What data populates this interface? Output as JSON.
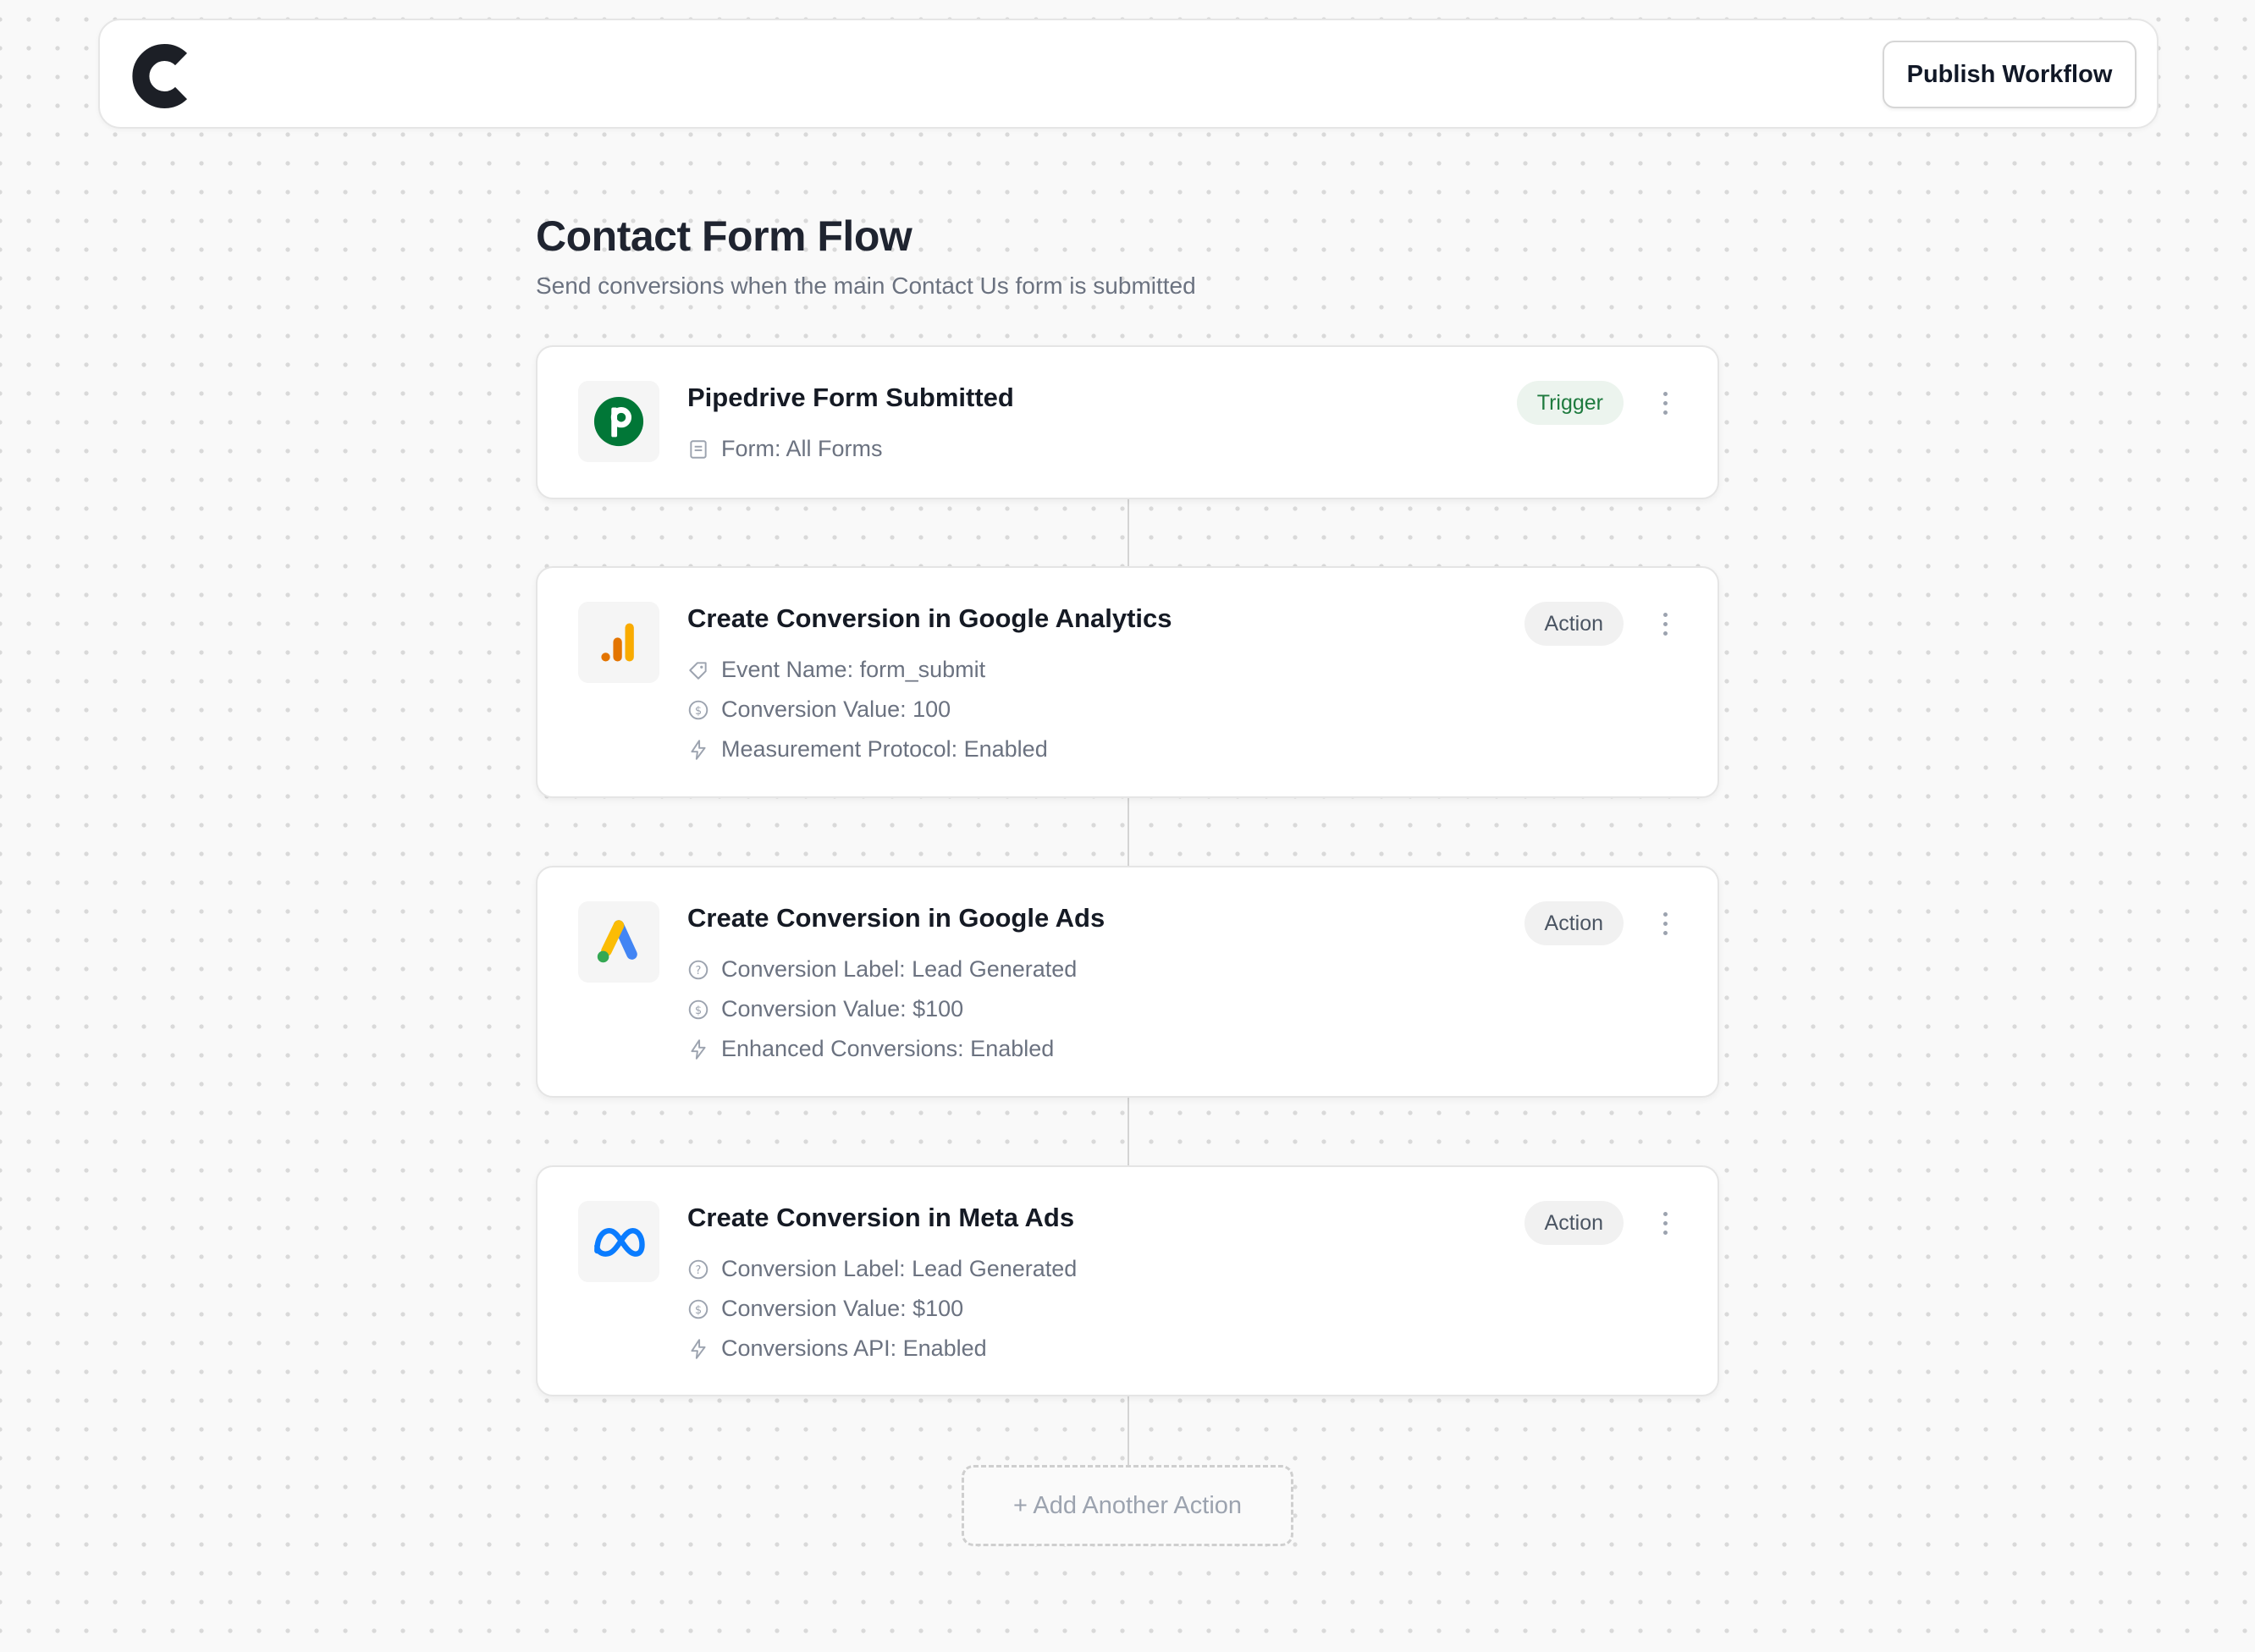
{
  "header": {
    "logo": "c-logo-icon",
    "publish_label": "Publish Workflow"
  },
  "flow": {
    "title": "Contact Form Flow",
    "subtitle": "Send conversions when the main Contact Us form is submitted"
  },
  "steps": [
    {
      "title": "Pipedrive Form Submitted",
      "badge": "Trigger",
      "app_icon": "pipedrive-icon",
      "details": [
        {
          "icon": "form-icon",
          "text": "Form: All Forms"
        }
      ]
    },
    {
      "title": "Create Conversion in Google Analytics",
      "badge": "Action",
      "app_icon": "google-analytics-icon",
      "details": [
        {
          "icon": "tag-icon",
          "text": "Event Name: form_submit"
        },
        {
          "icon": "dollar-icon",
          "text": "Conversion Value: 100"
        },
        {
          "icon": "bolt-icon",
          "text": "Measurement Protocol: Enabled"
        }
      ]
    },
    {
      "title": "Create Conversion in Google Ads",
      "badge": "Action",
      "app_icon": "google-ads-icon",
      "details": [
        {
          "icon": "help-circle-icon",
          "text": "Conversion Label: Lead Generated"
        },
        {
          "icon": "dollar-icon",
          "text": "Conversion Value: $100"
        },
        {
          "icon": "bolt-icon",
          "text": "Enhanced Conversions: Enabled"
        }
      ]
    },
    {
      "title": "Create Conversion in Meta Ads",
      "badge": "Action",
      "app_icon": "meta-icon",
      "details": [
        {
          "icon": "help-circle-icon",
          "text": "Conversion Label: Lead Generated"
        },
        {
          "icon": "dollar-icon",
          "text": "Conversion Value: $100"
        },
        {
          "icon": "bolt-icon",
          "text": "Conversions API: Enabled"
        }
      ]
    }
  ],
  "add_action_label": "+ Add Another Action",
  "colors": {
    "trigger_badge_text": "#1e7a3e",
    "pipedrive_green": "#017737",
    "analytics_orange": "#f9ab00",
    "ads_blue": "#4285f4",
    "meta_blue": "#0a7cff"
  }
}
